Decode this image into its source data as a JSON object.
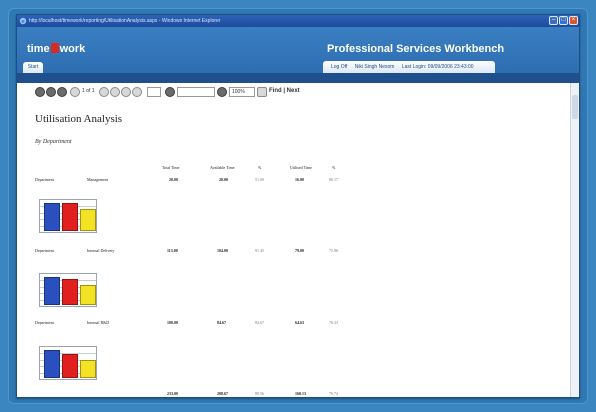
{
  "window": {
    "title": "http://localhost/timework/reporting/UtilisationAnalysis.aspx - Windows Internet Explorer"
  },
  "app": {
    "logo_part1": "time",
    "logo_part2": "work",
    "name": "Professional Services Workbench",
    "home_tab": "Start",
    "logout": "Log Off",
    "user": "Niki Singh Nesom",
    "last_login": "Last Login: 09/09/2006 23:43:00"
  },
  "toolbar": {
    "page_of": "1 of 1",
    "zoom": "100%",
    "find_label": "Find | Next"
  },
  "report": {
    "title": "Utilisation Analysis",
    "subtitle": "By Department",
    "columns": [
      "Total Time",
      "Available Time",
      "%",
      "Utilised Time",
      "%"
    ],
    "rows": [
      {
        "label": "Department",
        "name": "Management",
        "total": "20.00",
        "available": "20.00",
        "pct1": "51.00",
        "utilised": "16.00",
        "pct2": "80.17"
      },
      {
        "label": "Department",
        "name": "Internal Delivery",
        "total": "113.00",
        "available": "104.00",
        "pct1": "91.45",
        "utilised": "79.00",
        "pct2": "75.96"
      },
      {
        "label": "Department",
        "name": "Internal R&D",
        "total": "100.00",
        "available": "84.67",
        "pct1": "84.67",
        "utilised": "64.63",
        "pct2": "76.33"
      },
      {
        "label": "",
        "name": "",
        "total": "233.00",
        "available": "208.67",
        "pct1": "89.56",
        "utilised": "160.13",
        "pct2": "76.74"
      }
    ]
  },
  "colors": {
    "bar_total": "#2a4fbf",
    "bar_available": "#e21f1f",
    "bar_utilised": "#f4e224"
  },
  "charts": [
    {
      "values": [
        20.0,
        20.0,
        16.0
      ],
      "max": 20
    },
    {
      "values": [
        113.0,
        104.0,
        79.0
      ],
      "max": 113
    },
    {
      "values": [
        100.0,
        84.67,
        64.63
      ],
      "max": 100
    }
  ]
}
